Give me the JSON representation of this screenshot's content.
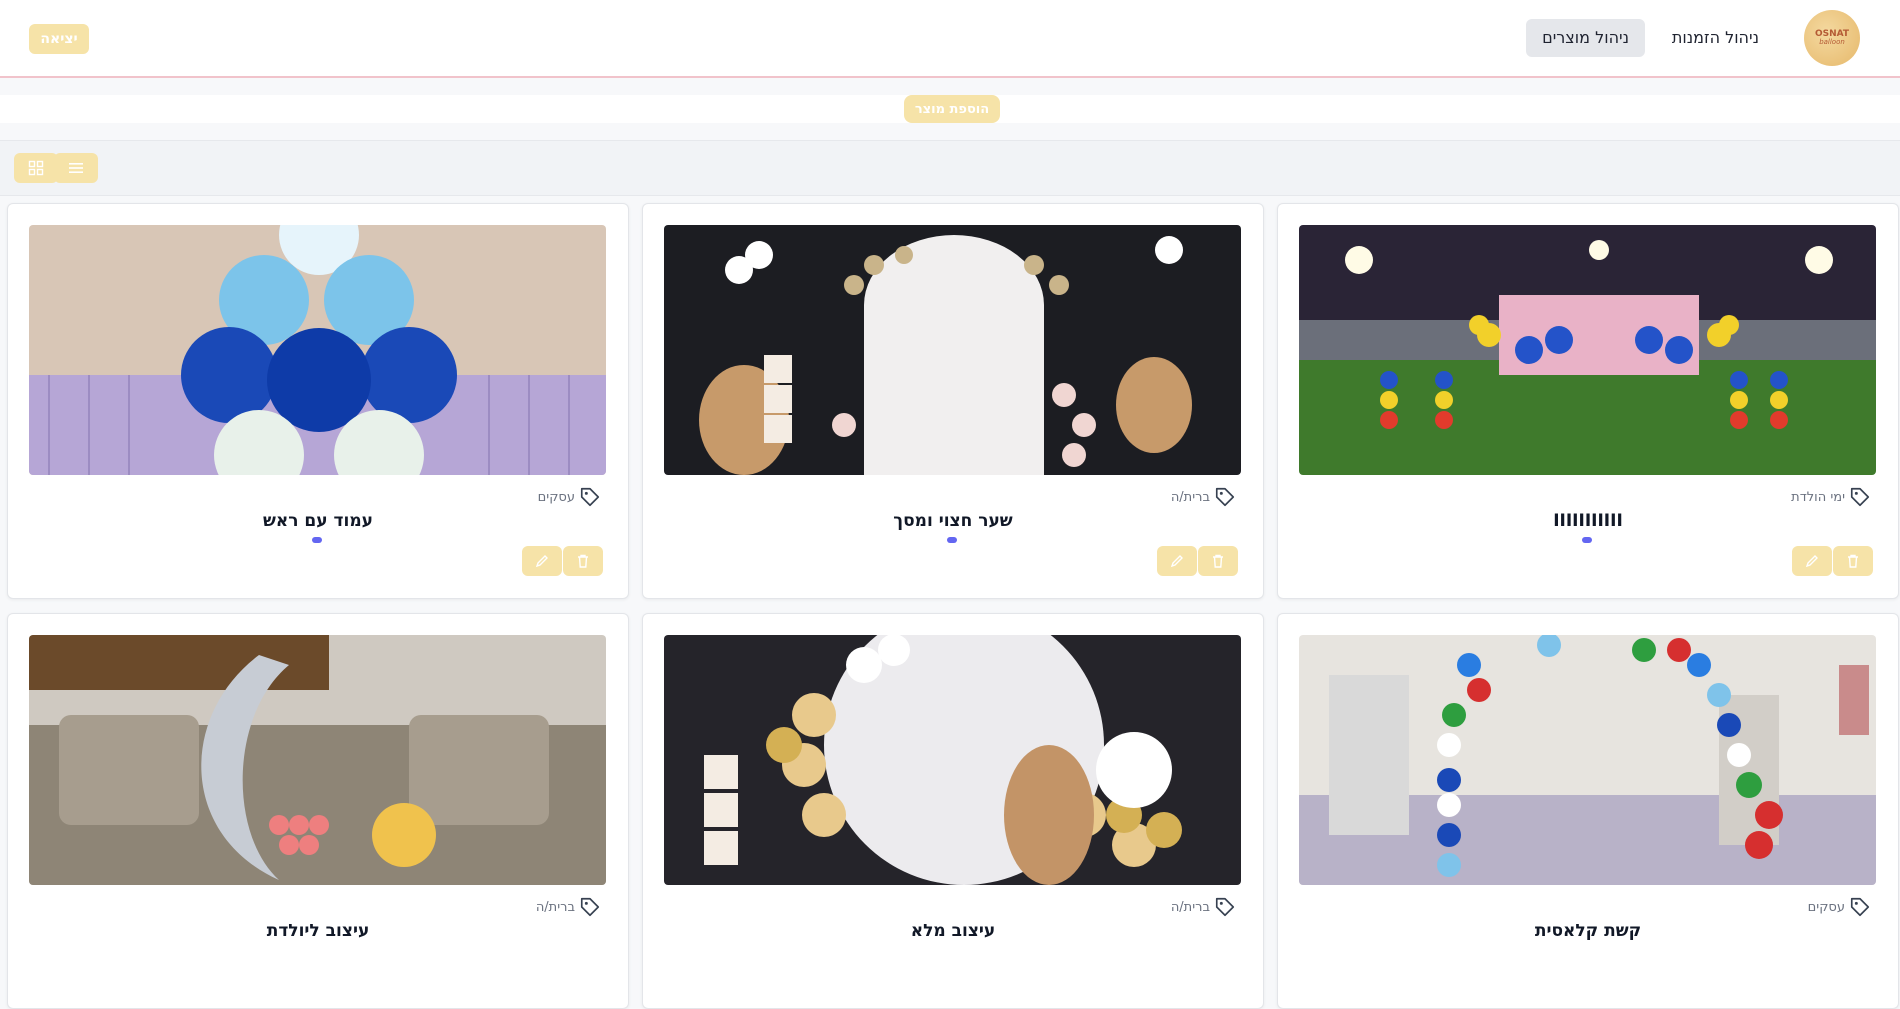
{
  "header": {
    "logo_line1": "OSNAT",
    "logo_line2": "balloon",
    "nav_orders": "ניהול הזמנות",
    "nav_products": "ניהול מוצרים",
    "logout": "יציאה"
  },
  "actions": {
    "add_product": "הוספת מוצר"
  },
  "products": [
    {
      "title": "IIIIIIIIIII",
      "category": "ימי הולדת"
    },
    {
      "title": "שער חצוי ומסך",
      "category": "ברית/ה"
    },
    {
      "title": "עמוד עם ראש",
      "category": "עסקים"
    },
    {
      "title": "קשת קלאסית",
      "category": "עסקים"
    },
    {
      "title": "עיצוב מלא",
      "category": "ברית/ה"
    },
    {
      "title": "עיצוב ליולדת",
      "category": "ברית/ה"
    }
  ],
  "colors": {
    "accent": "#f6e3a8",
    "indicator": "#6366f1",
    "header_border": "#f1c3cb"
  }
}
